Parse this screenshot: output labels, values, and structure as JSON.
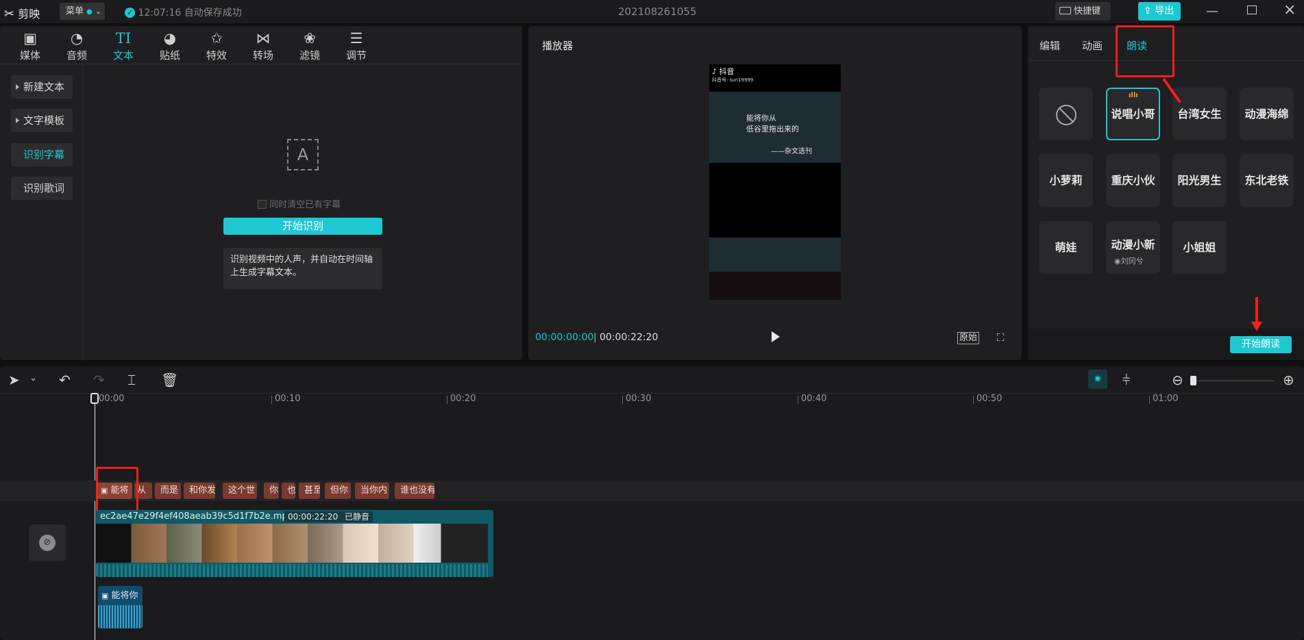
{
  "app": {
    "name": "剪映",
    "menu_label": "菜单",
    "autosave": "12:07:16 自动保存成功",
    "project_title": "202108261055",
    "shortcut_label": "快捷键",
    "export_label": "导出"
  },
  "toolbar": {
    "tabs": [
      {
        "label": "媒体",
        "icon": "media-icon"
      },
      {
        "label": "音频",
        "icon": "audio-icon"
      },
      {
        "label": "文本",
        "icon": "text-icon",
        "active": true
      },
      {
        "label": "贴纸",
        "icon": "sticker-icon"
      },
      {
        "label": "特效",
        "icon": "effects-icon"
      },
      {
        "label": "转场",
        "icon": "transition-icon"
      },
      {
        "label": "滤镜",
        "icon": "filter-icon"
      },
      {
        "label": "调节",
        "icon": "adjust-icon"
      }
    ]
  },
  "sidebar": {
    "items": [
      {
        "label": "新建文本"
      },
      {
        "label": "文字模板"
      },
      {
        "label": "识别字幕"
      },
      {
        "label": "识别歌词"
      }
    ]
  },
  "recognize": {
    "icon_text": "A",
    "checkbox_label": "同时清空已有字幕",
    "start_button": "开始识别",
    "description": "识别视频中的人声，并自动在时间轴上生成字幕文本。"
  },
  "player": {
    "title": "播放器",
    "current_time": "00:00:00:00",
    "total_time": "00:00:22:20",
    "ratio_label": "原始",
    "video": {
      "platform": "抖音",
      "account": "抖音号: sun19999",
      "lines": [
        "能将你从",
        "低谷里拖出来的",
        "——杂文选刊"
      ]
    }
  },
  "right_panel": {
    "tabs": [
      {
        "label": "编辑"
      },
      {
        "label": "动画"
      },
      {
        "label": "朗读",
        "active": true
      }
    ],
    "voices": [
      {
        "label": "",
        "icon": "none-icon"
      },
      {
        "label": "说唱小哥",
        "selected": true
      },
      {
        "label": "台湾女生"
      },
      {
        "label": "动漫海绵"
      },
      {
        "label": "小萝莉"
      },
      {
        "label": "重庆小伙"
      },
      {
        "label": "阳光男生"
      },
      {
        "label": "东北老铁"
      },
      {
        "label": "萌娃"
      },
      {
        "label": "动漫小新",
        "sub": "刘冈兮"
      },
      {
        "label": "小姐姐"
      }
    ],
    "start_read_button": "开始朗读"
  },
  "timeline": {
    "ticks": [
      "00:00",
      "00:10",
      "00:20",
      "00:30",
      "00:40",
      "00:50",
      "01:00"
    ],
    "text_clips": [
      "能将",
      "从",
      "而是",
      "和你发",
      "这个世",
      "你",
      "也",
      "甚至",
      "但你",
      "当你内",
      "谁也没有"
    ],
    "video_clip": {
      "filename": "ec2ae47e29f4ef408aeab39c5d1f7b2e.mp4",
      "duration": "00:00:22:20",
      "muted_label": "已静音"
    },
    "audio_clip": {
      "label": "能将你"
    }
  },
  "colors": {
    "accent": "#1ec8d2",
    "highlight": "#f2201b",
    "text_clip": "#7a3a30",
    "video_clip": "#0f5a66"
  }
}
